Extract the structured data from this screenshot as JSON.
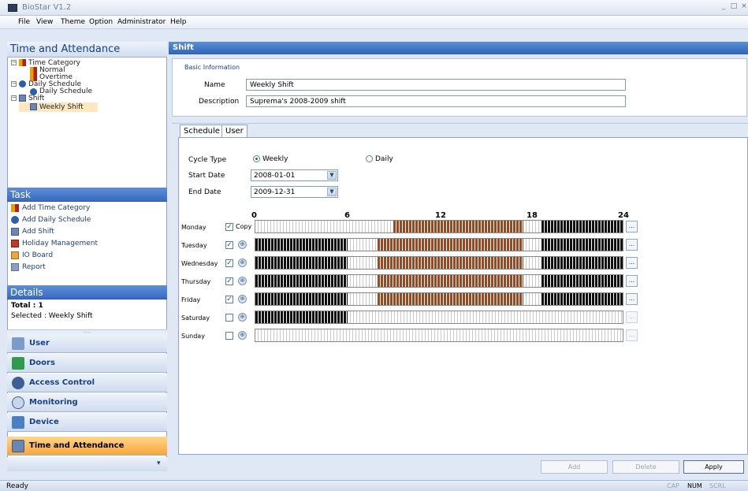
{
  "window": {
    "title": "BioStar V1.2",
    "minimize": "_",
    "maximize": "□",
    "close": "×"
  },
  "menu": [
    "File",
    "View",
    "Theme",
    "Option",
    "Administrator",
    "Help"
  ],
  "left": {
    "header": "Time and Attendance",
    "tree": {
      "time_category": "Time Category",
      "normal": "Normal",
      "overtime": "Overtime",
      "daily_schedule_group": "Daily Schedule",
      "daily_schedule": "Daily Schedule",
      "shift_group": "Shift",
      "weekly_shift": "Weekly Shift"
    },
    "task_header": "Task",
    "tasks": [
      "Add Time Category",
      "Add Daily Schedule",
      "Add Shift",
      "Holiday Management",
      "IO Board",
      "Report"
    ],
    "details_header": "Details",
    "details_total": "Total : 1",
    "details_selected": "Selected : Weekly Shift",
    "nav": [
      "User",
      "Doors",
      "Access Control",
      "Monitoring",
      "Device",
      "Time and Attendance"
    ]
  },
  "right": {
    "header": "Shift",
    "basic_info": "Basic Information",
    "name_label": "Name",
    "name_value": "Weekly Shift",
    "desc_label": "Description",
    "desc_value": "Suprema's 2008-2009 shift",
    "tab_schedule": "Schedule",
    "tab_user": "User",
    "cycle_label": "Cycle Type",
    "cycle_weekly": "Weekly",
    "cycle_daily": "Daily",
    "start_label": "Start Date",
    "start_value": "2008-01-01",
    "end_label": "End Date",
    "end_value": "2009-12-31",
    "copy_label": "Copy",
    "hours": [
      "0",
      "6",
      "12",
      "18",
      "24"
    ],
    "days": [
      "Monday",
      "Tuesday",
      "Wednesday",
      "Thursday",
      "Friday",
      "Saturday",
      "Sunday"
    ],
    "day_checked": [
      true,
      true,
      true,
      true,
      true,
      false,
      false
    ],
    "schedule_colors": {
      "night": "#111111",
      "day": "#a0461f",
      "empty": "#ffffff"
    },
    "btn_add": "Add",
    "btn_delete": "Delete",
    "btn_apply": "Apply"
  },
  "status": {
    "left": "Ready",
    "cap": "CAP",
    "num": "NUM",
    "scrl": "SCRL"
  }
}
